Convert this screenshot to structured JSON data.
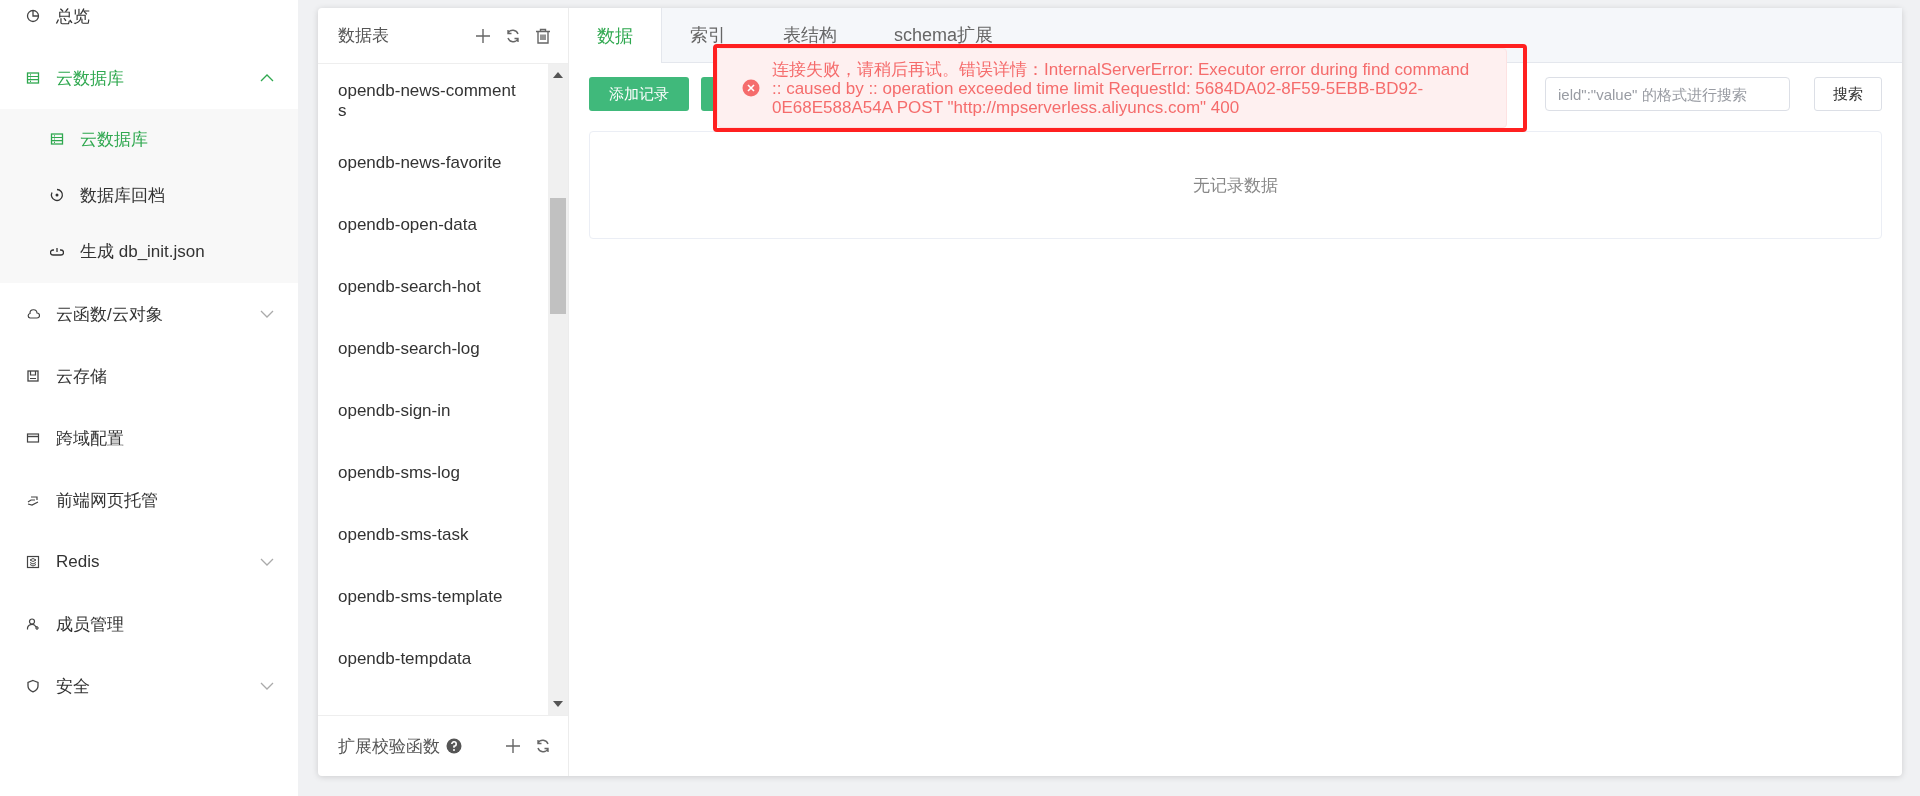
{
  "sidebar": {
    "items": [
      {
        "label": "总览",
        "selected": false
      },
      {
        "label": "云数据库",
        "selected": true,
        "expanded": true,
        "children": [
          {
            "label": "云数据库",
            "selected": true
          },
          {
            "label": "数据库回档",
            "selected": false
          },
          {
            "label": "生成 db_init.json",
            "selected": false
          }
        ]
      },
      {
        "label": "云函数/云对象",
        "selected": false,
        "expanded": false
      },
      {
        "label": "云存储",
        "selected": false
      },
      {
        "label": "跨域配置",
        "selected": false
      },
      {
        "label": "前端网页托管",
        "selected": false
      },
      {
        "label": "Redis",
        "selected": false,
        "expanded": false
      },
      {
        "label": "成员管理",
        "selected": false
      },
      {
        "label": "安全",
        "selected": false,
        "expanded": false
      }
    ]
  },
  "tables": {
    "title": "数据表",
    "items": [
      {
        "name": "opendb-news-comments",
        "selected": false
      },
      {
        "name": "opendb-news-favorite",
        "selected": false
      },
      {
        "name": "opendb-open-data",
        "selected": false
      },
      {
        "name": "opendb-search-hot",
        "selected": false
      },
      {
        "name": "opendb-search-log",
        "selected": false
      },
      {
        "name": "opendb-sign-in",
        "selected": false
      },
      {
        "name": "opendb-sms-log",
        "selected": false
      },
      {
        "name": "opendb-sms-task",
        "selected": false
      },
      {
        "name": "opendb-sms-template",
        "selected": false
      },
      {
        "name": "opendb-tempdata",
        "selected": false
      }
    ],
    "footer": "扩展校验函数"
  },
  "tabs": [
    {
      "label": "数据",
      "selected": true
    },
    {
      "label": "索引",
      "selected": false
    },
    {
      "label": "表结构",
      "selected": false
    },
    {
      "label": "schema扩展",
      "selected": false
    }
  ],
  "toolbar": {
    "add_button": "添加记录",
    "search": {
      "placeholder": "ield\":\"value\" 的格式进行搜索"
    },
    "search_button": "搜索"
  },
  "empty_text": "无记录数据",
  "toast": {
    "message": "连接失败，请稍后再试。错误详情：InternalServerError: Executor error during find command :: caused by :: operation exceeded time limit RequestId: 5684DA02-8F59-5EBB-BD92-0E68E588A54A POST \"http://mpserverless.aliyuncs.com\" 400"
  }
}
